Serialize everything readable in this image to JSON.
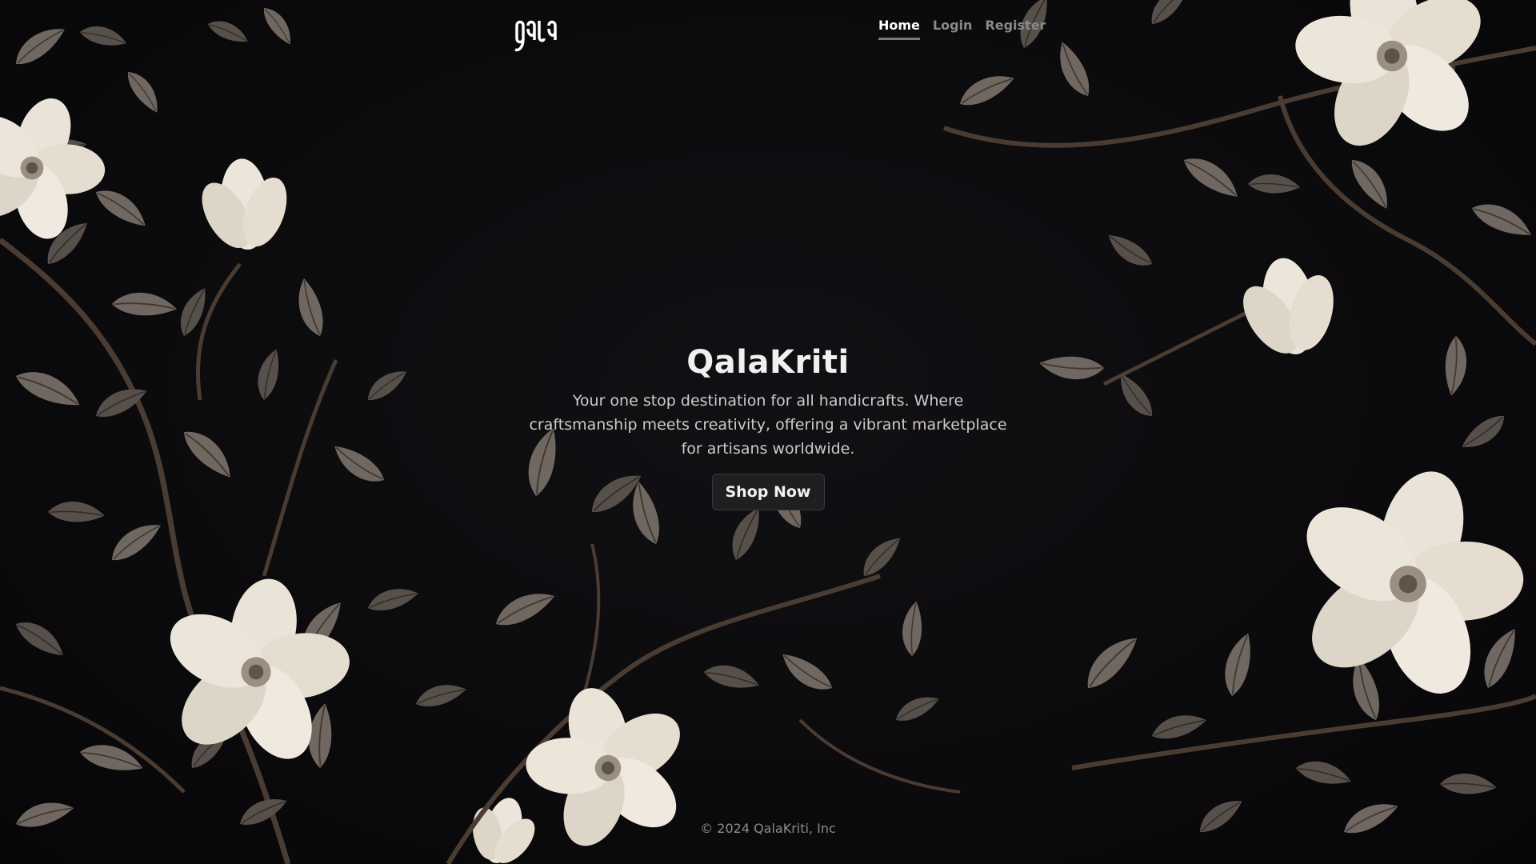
{
  "brand": {
    "logo_icon": "qala-logo-icon",
    "name": "QalaKriti"
  },
  "nav": {
    "items": [
      {
        "label": "Home",
        "active": true
      },
      {
        "label": "Login",
        "active": false
      },
      {
        "label": "Register",
        "active": false
      }
    ]
  },
  "hero": {
    "title": "QalaKriti",
    "subtitle": "Your one stop destination for all handicrafts. Where craftsmanship meets creativity, offering a vibrant marketplace for artisans worldwide.",
    "cta_label": "Shop Now"
  },
  "footer": {
    "copyright": "© 2024 QalaKriti, Inc"
  },
  "colors": {
    "background": "#0b0a0c",
    "leaf": "#6f6760",
    "leaf_dark": "#4f4944",
    "petal": "#ece6dc",
    "stem": "#4a3c32",
    "accent_underline": "#7a7a7a"
  },
  "background_image": "floral-magnolia-pattern"
}
